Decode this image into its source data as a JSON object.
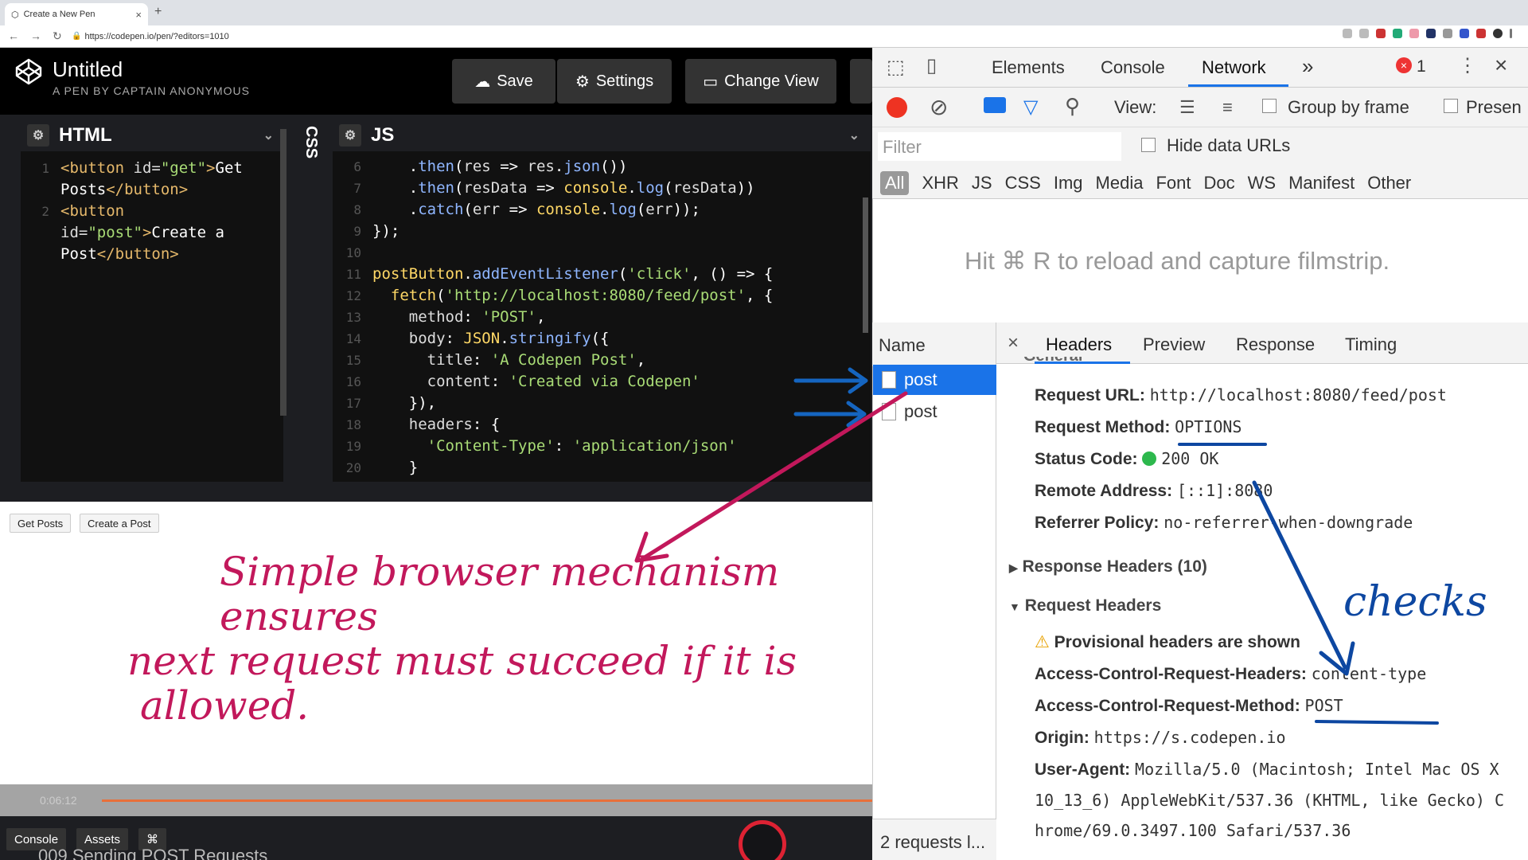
{
  "browser": {
    "tab_title": "Create a New Pen",
    "url": "https://codepen.io/pen/?editors=1010"
  },
  "codepen": {
    "title": "Untitled",
    "subtitle": "A PEN BY CAPTAIN ANONYMOUS",
    "buttons": {
      "save": "Save",
      "settings": "Settings",
      "change_view": "Change View"
    },
    "html_panel": {
      "label": "HTML"
    },
    "css_panel": {
      "label": "CSS"
    },
    "js_panel": {
      "label": "JS"
    },
    "html_lines": [
      {
        "n": "1",
        "parts": [
          [
            "tag",
            "<button "
          ],
          [
            "attr",
            "id="
          ],
          [
            "str",
            "\"get\""
          ],
          [
            "tag",
            ">"
          ],
          [
            "plain",
            "Get"
          ]
        ]
      },
      {
        "n": "",
        "parts": [
          [
            "plain",
            "Posts"
          ],
          [
            "tag",
            "</button>"
          ]
        ]
      },
      {
        "n": "2",
        "parts": [
          [
            "tag",
            "<button"
          ]
        ]
      },
      {
        "n": "",
        "parts": [
          [
            "attr",
            "id="
          ],
          [
            "str",
            "\"post\""
          ],
          [
            "tag",
            ">"
          ],
          [
            "plain",
            "Create a"
          ]
        ]
      },
      {
        "n": "",
        "parts": [
          [
            "plain",
            "Post"
          ],
          [
            "tag",
            "</button>"
          ]
        ]
      }
    ],
    "js_lines": [
      {
        "n": "6",
        "parts": [
          [
            "plain",
            "    ."
          ],
          [
            "fn",
            "then"
          ],
          [
            "plain",
            "("
          ],
          [
            "attr",
            "res"
          ],
          [
            "plain",
            " => "
          ],
          [
            "attr",
            "res"
          ],
          [
            "plain",
            "."
          ],
          [
            "fn",
            "json"
          ],
          [
            "plain",
            "())"
          ]
        ]
      },
      {
        "n": "7",
        "parts": [
          [
            "plain",
            "    ."
          ],
          [
            "fn",
            "then"
          ],
          [
            "plain",
            "("
          ],
          [
            "attr",
            "resData"
          ],
          [
            "plain",
            " => "
          ],
          [
            "kw",
            "console"
          ],
          [
            "plain",
            "."
          ],
          [
            "fn",
            "log"
          ],
          [
            "plain",
            "("
          ],
          [
            "attr",
            "resData"
          ],
          [
            "plain",
            "))"
          ]
        ]
      },
      {
        "n": "8",
        "parts": [
          [
            "plain",
            "    ."
          ],
          [
            "fn",
            "catch"
          ],
          [
            "plain",
            "("
          ],
          [
            "attr",
            "err"
          ],
          [
            "plain",
            " => "
          ],
          [
            "kw",
            "console"
          ],
          [
            "plain",
            "."
          ],
          [
            "fn",
            "log"
          ],
          [
            "plain",
            "("
          ],
          [
            "attr",
            "err"
          ],
          [
            "plain",
            "));"
          ]
        ]
      },
      {
        "n": "9",
        "parts": [
          [
            "plain",
            "});"
          ]
        ]
      },
      {
        "n": "10",
        "parts": [
          [
            "plain",
            ""
          ]
        ]
      },
      {
        "n": "11",
        "parts": [
          [
            "kw",
            "postButton"
          ],
          [
            "plain",
            "."
          ],
          [
            "fn",
            "addEventListener"
          ],
          [
            "plain",
            "("
          ],
          [
            "str",
            "'click'"
          ],
          [
            "plain",
            ", () => {"
          ]
        ]
      },
      {
        "n": "12",
        "parts": [
          [
            "plain",
            "  "
          ],
          [
            "kw",
            "fetch"
          ],
          [
            "plain",
            "("
          ],
          [
            "str",
            "'http://localhost:8080/feed/post'"
          ],
          [
            "plain",
            ", {"
          ]
        ]
      },
      {
        "n": "13",
        "parts": [
          [
            "plain",
            "    "
          ],
          [
            "attr",
            "method"
          ],
          [
            "plain",
            ": "
          ],
          [
            "str",
            "'POST'"
          ],
          [
            "plain",
            ","
          ]
        ]
      },
      {
        "n": "14",
        "parts": [
          [
            "plain",
            "    "
          ],
          [
            "attr",
            "body"
          ],
          [
            "plain",
            ": "
          ],
          [
            "kw",
            "JSON"
          ],
          [
            "plain",
            "."
          ],
          [
            "fn",
            "stringify"
          ],
          [
            "plain",
            "({"
          ]
        ]
      },
      {
        "n": "15",
        "parts": [
          [
            "plain",
            "      "
          ],
          [
            "attr",
            "title"
          ],
          [
            "plain",
            ": "
          ],
          [
            "str",
            "'A Codepen Post'"
          ],
          [
            "plain",
            ","
          ]
        ]
      },
      {
        "n": "16",
        "parts": [
          [
            "plain",
            "      "
          ],
          [
            "attr",
            "content"
          ],
          [
            "plain",
            ": "
          ],
          [
            "str",
            "'Created via Codepen'"
          ]
        ]
      },
      {
        "n": "17",
        "parts": [
          [
            "plain",
            "    }),"
          ]
        ]
      },
      {
        "n": "18",
        "parts": [
          [
            "plain",
            "    "
          ],
          [
            "attr",
            "headers"
          ],
          [
            "plain",
            ": {"
          ]
        ]
      },
      {
        "n": "19",
        "parts": [
          [
            "plain",
            "      "
          ],
          [
            "str",
            "'Content-Type'"
          ],
          [
            "plain",
            ": "
          ],
          [
            "str",
            "'application/json'"
          ]
        ]
      },
      {
        "n": "20",
        "parts": [
          [
            "plain",
            "    }"
          ]
        ]
      }
    ],
    "preview_buttons": {
      "get": "Get Posts",
      "create": "Create a Post"
    },
    "footer": {
      "console": "Console",
      "assets": "Assets",
      "shortcut": "⌘"
    }
  },
  "annotation": {
    "line1": "Simple browser mechanism ensures",
    "line2": "next request must succeed if it is",
    "line3": "allowed.",
    "checks": "checks"
  },
  "player": {
    "timecode": "0:06:12",
    "lecture": "009 Sending POST Requests"
  },
  "devtools": {
    "tabs": {
      "elements": "Elements",
      "console": "Console",
      "network": "Network",
      "more": "»"
    },
    "error_count": "1",
    "toolbar": {
      "view": "View:",
      "group_by_frame": "Group by frame",
      "preserve": "Presen"
    },
    "filter_placeholder": "Filter",
    "hide_data_urls": "Hide data URLs",
    "type_filters": [
      "All",
      "XHR",
      "JS",
      "CSS",
      "Img",
      "Media",
      "Font",
      "Doc",
      "WS",
      "Manifest",
      "Other"
    ],
    "filmstrip_hint": "Hit ⌘ R to reload and capture filmstrip.",
    "name_header": "Name",
    "requests": [
      "post",
      "post"
    ],
    "request_count": "2 requests l...",
    "detail_tabs": {
      "close": "×",
      "headers": "Headers",
      "preview": "Preview",
      "response": "Response",
      "timing": "Timing"
    },
    "general_partial": "General",
    "general": {
      "request_url_label": "Request URL:",
      "request_url": "http://localhost:8080/feed/post",
      "request_method_label": "Request Method:",
      "request_method": "OPTIONS",
      "status_code_label": "Status Code:",
      "status_code": "200 OK",
      "remote_address_label": "Remote Address:",
      "remote_address": "[::1]:8080",
      "referrer_policy_label": "Referrer Policy:",
      "referrer_policy": "no-referrer-when-downgrade"
    },
    "response_headers": "Response Headers (10)",
    "request_headers": "Request Headers",
    "provisional": "Provisional headers are shown",
    "req_headers": {
      "acrh_label": "Access-Control-Request-Headers:",
      "acrh": "content-type",
      "acrm_label": "Access-Control-Request-Method:",
      "acrm": "POST",
      "origin_label": "Origin:",
      "origin": "https://s.codepen.io",
      "ua_label": "User-Agent:",
      "ua1": "Mozilla/5.0 (Macintosh; Intel Mac OS X",
      "ua2": "10_13_6) AppleWebKit/537.36 (KHTML, like Gecko) C",
      "ua3": "hrome/69.0.3497.100 Safari/537.36"
    }
  },
  "colors": {
    "accent": "#1a73e8",
    "ink_red": "#c2185b",
    "ink_blue": "#0d47a1",
    "status_green": "#2db84d"
  }
}
